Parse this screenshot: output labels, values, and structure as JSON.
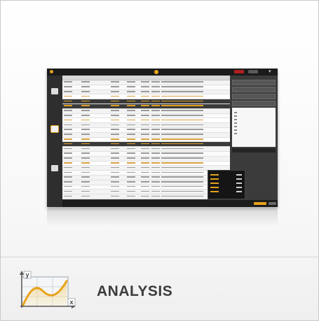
{
  "card": {
    "title": "ANALYSIS",
    "icon": "analysis-chart-icon",
    "icon_axis_y": "y",
    "icon_axis_x": "x"
  },
  "preview": {
    "kind": "application-screenshot-thumbnail",
    "accent_color": "#f0a818",
    "nav_icons": [
      "table-icon",
      "chart-icon",
      "settings-icon"
    ]
  },
  "colors": {
    "accent": "#f0a818",
    "title_text": "#3c3c3c",
    "icon_curve": "#e8a21a"
  }
}
